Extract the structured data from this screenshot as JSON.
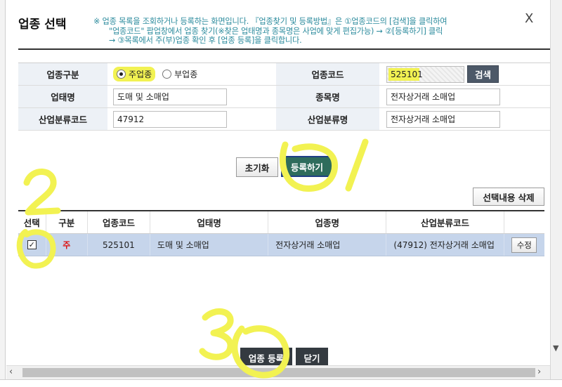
{
  "modal": {
    "title": "업종 선택",
    "description": [
      "※ 업종 목록을 조회하거나 등록하는 화면입니다.  『업종찾기 및 등록방법』은 ①업종코드의 [검색]을 클릭하여",
      "\"업종코드\" 팝업창에서 업종 찾기(※찾은 업태명과 종목명은 사업에 맞게 편집가능) → ②[등록하기] 클릭",
      "→ ③목록에서 주(부)업종 확인 후 [업종 등록]을 클릭합니다."
    ],
    "close_label": "X"
  },
  "form": {
    "type_label": "업종구분",
    "main_option": "주업종",
    "sub_option": "부업종",
    "selected_option": "주업종",
    "code_label": "업종코드",
    "code_value": "525101",
    "search_button": "검색",
    "business_label": "업태명",
    "business_value": "도매 및 소매업",
    "item_label": "종목명",
    "item_value": "전자상거래 소매업",
    "industry_code_label": "산업분류코드",
    "industry_code_value": "47912",
    "industry_name_label": "산업분류명",
    "industry_name_value": "전자상거래 소매업"
  },
  "actions": {
    "reset": "초기화",
    "register": "등록하기",
    "delete_selected": "선택내용 삭제"
  },
  "table": {
    "headers": [
      "선택",
      "구분",
      "업종코드",
      "업태명",
      "업종명",
      "산업분류코드",
      ""
    ],
    "rows": [
      {
        "checked": true,
        "type": "주",
        "code": "525101",
        "business": "도매 및 소매업",
        "item": "전자상거래 소매업",
        "industry": "(47912) 전자상거래 소매업",
        "edit": "수정"
      }
    ]
  },
  "footer": {
    "register": "업종 등록",
    "close": "닫기"
  },
  "colors": {
    "annotation": "#f2f252",
    "header_bg": "#edf1f6",
    "row_selected": "#c6d5eb",
    "register_btn": "#2e6c5c",
    "dark_btn": "#343a40",
    "desc_text": "#2a8a9c"
  },
  "annotations": [
    "2",
    "1",
    "3"
  ]
}
